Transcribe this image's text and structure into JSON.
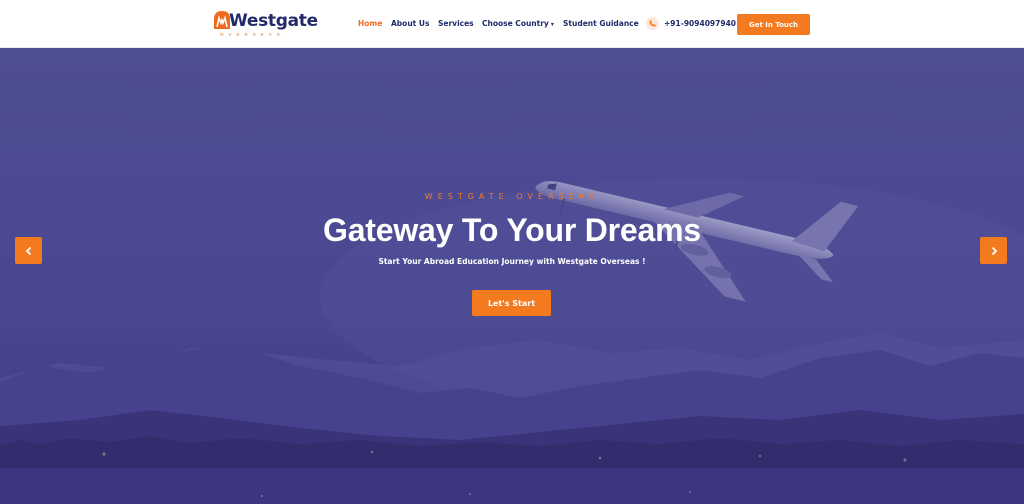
{
  "brand": {
    "name": "Westgate",
    "tagline": "OVERSEAS"
  },
  "nav": {
    "items": [
      {
        "label": "Home",
        "active": true
      },
      {
        "label": "About Us",
        "active": false
      },
      {
        "label": "Services",
        "active": false
      },
      {
        "label": "Choose Country",
        "active": false,
        "dropdown": true
      },
      {
        "label": "Student Guidance",
        "active": false
      }
    ],
    "phone": "+91-9094097940",
    "cta_label": "Get In Touch"
  },
  "hero": {
    "eyebrow": "WESTGATE OVERSEAS",
    "title": "Gateway To Your Dreams",
    "subtitle": "Start Your Abroad Education Journey with Westgate Overseas !",
    "button_label": "Let's Start",
    "prev_icon": "chevron-left-icon",
    "next_icon": "chevron-right-icon"
  },
  "colors": {
    "accent": "#f47a20",
    "navy": "#1f2a6a",
    "hero_overlay": "#4a4a90"
  }
}
